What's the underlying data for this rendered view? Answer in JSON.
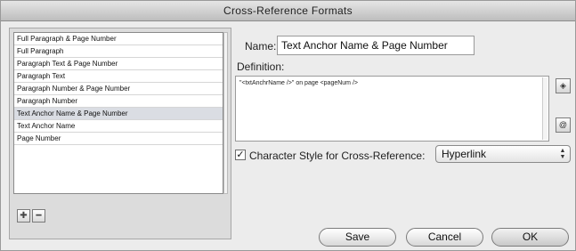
{
  "window": {
    "title": "Cross-Reference Formats"
  },
  "formats_list": {
    "items": [
      "Full Paragraph & Page Number",
      "Full Paragraph",
      "Paragraph Text & Page Number",
      "Paragraph Text",
      "Paragraph Number & Page Number",
      "Paragraph Number",
      "Text Anchor Name & Page Number",
      "Text Anchor Name",
      "Page Number"
    ],
    "selected_index": 6,
    "add_icon": "plus-icon",
    "remove_icon": "minus-icon"
  },
  "editor": {
    "name_label": "Name:",
    "name_value": "Text Anchor Name & Page Number",
    "definition_label": "Definition:",
    "definition_value": "\"<txtAnchrName />\" on page <pageNum />",
    "insert_building_block_icon": "insert-building-block-icon",
    "insert_special_character_icon": "insert-special-character-icon",
    "char_style_label": "Character Style for Cross-Reference:",
    "char_style_checked": true,
    "char_style_value": "Hyperlink"
  },
  "buttons": {
    "save": "Save",
    "cancel": "Cancel",
    "ok": "OK"
  }
}
